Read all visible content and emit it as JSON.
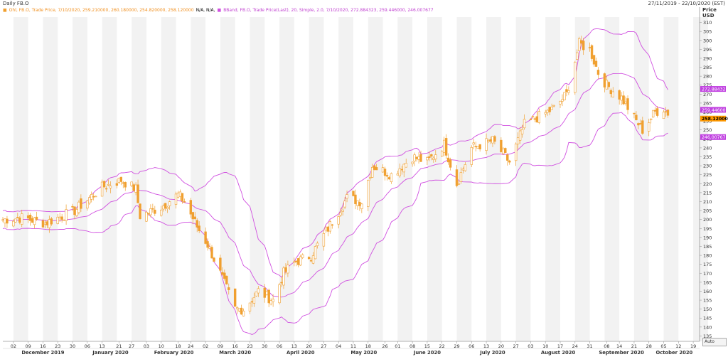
{
  "header": {
    "title": "Daily FB.O",
    "date_range": "27/11/2019 - 22/10/2020 (EST)"
  },
  "legend": {
    "ohlc_label": "Ohl, FB.O, Trade Price, 7/10/2020, 259.210000, 260.180000, 254.820000, 258.120000",
    "na_label": "N/A, N/A,",
    "bband_label": "BBand, FB.O, Trade Price(Last), 20, Simple, 2.0, 7/10/2020, 272.884323, 259.446000, 246.007677"
  },
  "price_axis": {
    "title_line1": "Price",
    "title_line2": "USD"
  },
  "auto_button": "Auto",
  "colors": {
    "candle": "#f0a030",
    "bband": "#d050e0",
    "upper_tag": "#c040e0",
    "last_tag": "#ff9900",
    "weekend_band": "#f2f2f2"
  },
  "chart_data": {
    "type": "candlestick",
    "ylim": [
      132,
      313
    ],
    "yticks": [
      135,
      140,
      145,
      150,
      155,
      160,
      165,
      170,
      175,
      180,
      185,
      190,
      195,
      200,
      205,
      210,
      215,
      220,
      225,
      230,
      235,
      240,
      245,
      250,
      255,
      260,
      265,
      270,
      275,
      280,
      285,
      290,
      295,
      300,
      305,
      310
    ],
    "start_date": "2019-11-27",
    "end_date": "2020-10-22",
    "last_date": "2020-10-07",
    "day_ticks": [
      {
        "date": "2019-12-02",
        "label": "02"
      },
      {
        "date": "2019-12-09",
        "label": "09"
      },
      {
        "date": "2019-12-16",
        "label": "16"
      },
      {
        "date": "2019-12-23",
        "label": "23"
      },
      {
        "date": "2019-12-30",
        "label": "30"
      },
      {
        "date": "2020-01-06",
        "label": "06"
      },
      {
        "date": "2020-01-13",
        "label": "13"
      },
      {
        "date": "2020-01-21",
        "label": "21"
      },
      {
        "date": "2020-01-27",
        "label": "27"
      },
      {
        "date": "2020-02-03",
        "label": "03"
      },
      {
        "date": "2020-02-10",
        "label": "10"
      },
      {
        "date": "2020-02-18",
        "label": "18"
      },
      {
        "date": "2020-02-24",
        "label": "24"
      },
      {
        "date": "2020-03-02",
        "label": "02"
      },
      {
        "date": "2020-03-09",
        "label": "09"
      },
      {
        "date": "2020-03-16",
        "label": "16"
      },
      {
        "date": "2020-03-23",
        "label": "23"
      },
      {
        "date": "2020-03-30",
        "label": "30"
      },
      {
        "date": "2020-04-06",
        "label": "06"
      },
      {
        "date": "2020-04-13",
        "label": "13"
      },
      {
        "date": "2020-04-20",
        "label": "20"
      },
      {
        "date": "2020-04-27",
        "label": "27"
      },
      {
        "date": "2020-05-04",
        "label": "04"
      },
      {
        "date": "2020-05-11",
        "label": "11"
      },
      {
        "date": "2020-05-18",
        "label": "18"
      },
      {
        "date": "2020-05-26",
        "label": "26"
      },
      {
        "date": "2020-06-01",
        "label": "01"
      },
      {
        "date": "2020-06-08",
        "label": "08"
      },
      {
        "date": "2020-06-15",
        "label": "15"
      },
      {
        "date": "2020-06-22",
        "label": "22"
      },
      {
        "date": "2020-06-29",
        "label": "29"
      },
      {
        "date": "2020-07-06",
        "label": "06"
      },
      {
        "date": "2020-07-13",
        "label": "13"
      },
      {
        "date": "2020-07-20",
        "label": "20"
      },
      {
        "date": "2020-07-27",
        "label": "27"
      },
      {
        "date": "2020-08-03",
        "label": "03"
      },
      {
        "date": "2020-08-10",
        "label": "10"
      },
      {
        "date": "2020-08-17",
        "label": "17"
      },
      {
        "date": "2020-08-24",
        "label": "24"
      },
      {
        "date": "2020-08-31",
        "label": "31"
      },
      {
        "date": "2020-09-08",
        "label": "08"
      },
      {
        "date": "2020-09-14",
        "label": "14"
      },
      {
        "date": "2020-09-21",
        "label": "21"
      },
      {
        "date": "2020-09-28",
        "label": "28"
      },
      {
        "date": "2020-10-05",
        "label": "05"
      },
      {
        "date": "2020-10-12",
        "label": "12"
      },
      {
        "date": "2020-10-19",
        "label": "19"
      }
    ],
    "month_labels": [
      {
        "date": "2019-12-16",
        "label": "December 2019"
      },
      {
        "date": "2020-01-17",
        "label": "January 2020"
      },
      {
        "date": "2020-02-16",
        "label": "February 2020"
      },
      {
        "date": "2020-03-16",
        "label": "March 2020"
      },
      {
        "date": "2020-04-16",
        "label": "April 2020"
      },
      {
        "date": "2020-05-16",
        "label": "May 2020"
      },
      {
        "date": "2020-06-15",
        "label": "June 2020"
      },
      {
        "date": "2020-07-16",
        "label": "July 2020"
      },
      {
        "date": "2020-08-16",
        "label": "August 2020"
      },
      {
        "date": "2020-09-15",
        "label": "September 2020"
      },
      {
        "date": "2020-10-10",
        "label": "October 2020"
      }
    ],
    "close_keypoints": [
      [
        "2019-11-27",
        200
      ],
      [
        "2019-12-06",
        201
      ],
      [
        "2019-12-17",
        198
      ],
      [
        "2019-12-31",
        205
      ],
      [
        "2020-01-13",
        218
      ],
      [
        "2020-01-22",
        222
      ],
      [
        "2020-01-29",
        217
      ],
      [
        "2020-01-31",
        202
      ],
      [
        "2020-02-10",
        207
      ],
      [
        "2020-02-18",
        214
      ],
      [
        "2020-02-21",
        210
      ],
      [
        "2020-02-27",
        196
      ],
      [
        "2020-03-03",
        186
      ],
      [
        "2020-03-09",
        170
      ],
      [
        "2020-03-16",
        150
      ],
      [
        "2020-03-20",
        150
      ],
      [
        "2020-03-27",
        160
      ],
      [
        "2020-04-03",
        155
      ],
      [
        "2020-04-08",
        170
      ],
      [
        "2020-04-13",
        176
      ],
      [
        "2020-04-21",
        180
      ],
      [
        "2020-04-29",
        195
      ],
      [
        "2020-05-08",
        212
      ],
      [
        "2020-05-15",
        210
      ],
      [
        "2020-05-20",
        230
      ],
      [
        "2020-05-29",
        225
      ],
      [
        "2020-06-08",
        235
      ],
      [
        "2020-06-15",
        232
      ],
      [
        "2020-06-23",
        242
      ],
      [
        "2020-06-29",
        220
      ],
      [
        "2020-07-06",
        240
      ],
      [
        "2020-07-16",
        244
      ],
      [
        "2020-07-24",
        232
      ],
      [
        "2020-07-31",
        253
      ],
      [
        "2020-08-14",
        262
      ],
      [
        "2020-08-20",
        270
      ],
      [
        "2020-08-26",
        298
      ],
      [
        "2020-08-31",
        295
      ],
      [
        "2020-09-04",
        282
      ],
      [
        "2020-09-08",
        275
      ],
      [
        "2020-09-15",
        268
      ],
      [
        "2020-09-22",
        255
      ],
      [
        "2020-09-25",
        250
      ],
      [
        "2020-10-01",
        260
      ],
      [
        "2020-10-05",
        262
      ],
      [
        "2020-10-07",
        258.12
      ]
    ],
    "bband_period": 20,
    "bband_stddev": 2.0,
    "price_tags": [
      {
        "label": "272.884323",
        "value": 272.884323,
        "kind": "upper"
      },
      {
        "label": "259.446000",
        "value": 259.446,
        "kind": "middle"
      },
      {
        "label": "258.120000",
        "value": 258.12,
        "kind": "last"
      },
      {
        "label": "246.007677",
        "value": 246.007677,
        "kind": "lower"
      }
    ]
  }
}
